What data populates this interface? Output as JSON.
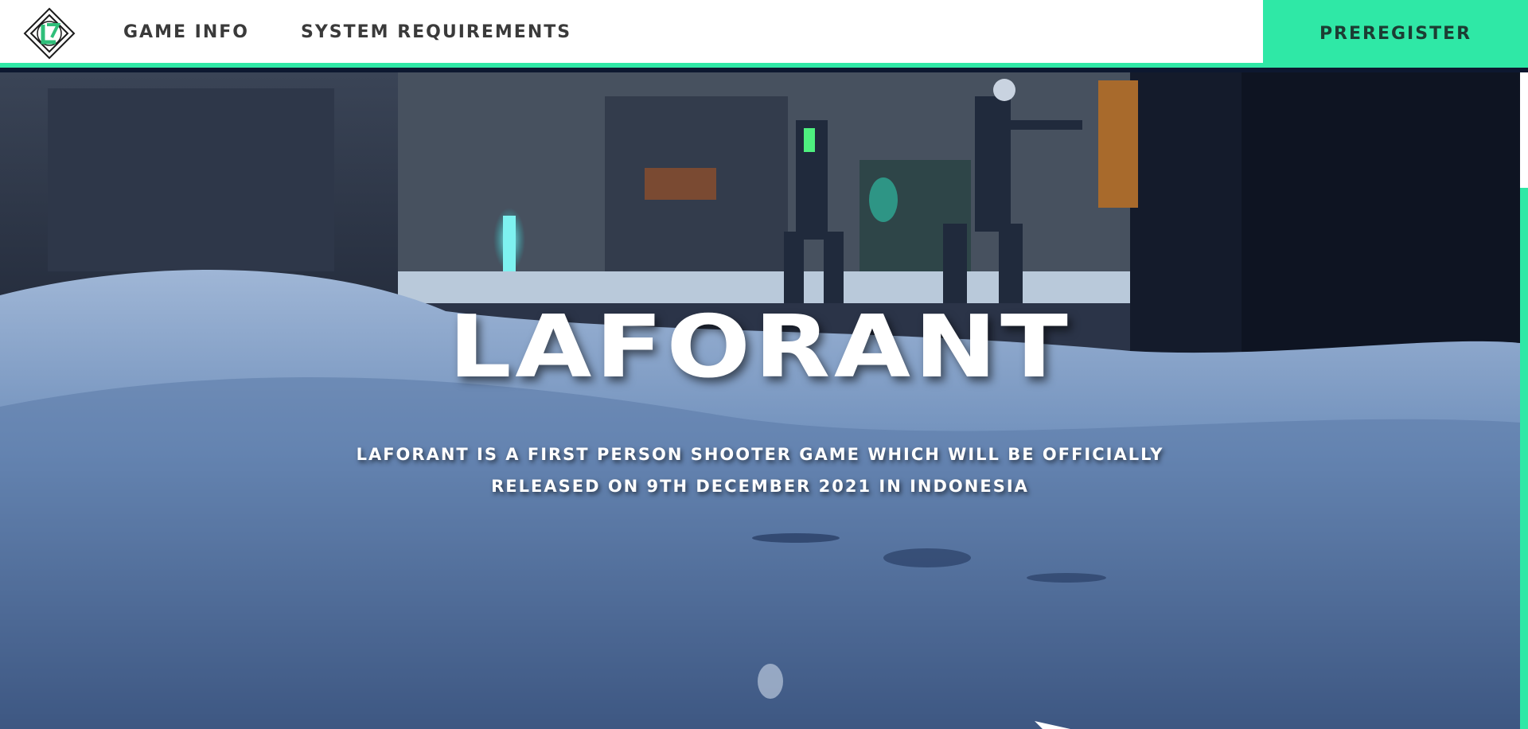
{
  "nav": {
    "logo_alt": "Laforant logo",
    "links": [
      {
        "label": "GAME INFO"
      },
      {
        "label": "SYSTEM REQUIREMENTS"
      }
    ],
    "cta_label": "PREREGISTER"
  },
  "hero": {
    "title": "LAFORANT",
    "description": "LAFORANT IS A FIRST PERSON SHOOTER GAME WHICH WILL BE OFFICIALLY RELEASED ON 9TH DECEMBER 2021 IN INDONESIA"
  },
  "colors": {
    "accent": "#2fe8a6",
    "nav_text": "#3a3a3a",
    "cta_text": "#1c3d33",
    "hero_text": "#ffffff"
  },
  "icons": {
    "logo": "laforant-logo-icon"
  }
}
